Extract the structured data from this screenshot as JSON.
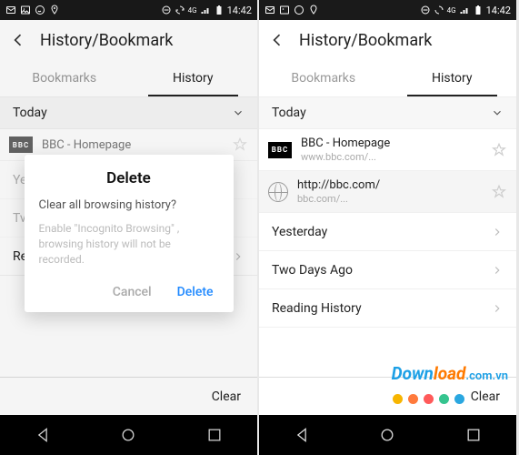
{
  "status": {
    "time": "14:42",
    "net_label": "4G"
  },
  "header": {
    "title": "History/Bookmark"
  },
  "tabs": {
    "bookmarks": "Bookmarks",
    "history": "History"
  },
  "sections": {
    "today": "Today",
    "yesterday": "Yesterday",
    "two_days": "Two Days Ago",
    "reading": "Reading History",
    "yesterday_trunc": "Ye",
    "two_days_trunc": "Tv"
  },
  "entries": {
    "bbc": {
      "title": "BBC - Homepage",
      "url": "www.bbc.com/...",
      "favicon_text": "BBC"
    },
    "bbc2": {
      "title": "http://bbc.com/",
      "url": "bbc.com/..."
    }
  },
  "dialog": {
    "title": "Delete",
    "message": "Clear all browsing history?",
    "hint": "Enable \"Incognito Browsing\" , browsing history will not be recorded.",
    "cancel": "Cancel",
    "confirm": "Delete"
  },
  "bottom": {
    "clear": "Clear"
  },
  "watermark": {
    "part1": "Down",
    "part2": "load",
    "tld": ".com.vn"
  },
  "dot_colors": [
    "#f7b500",
    "#ff7a3c",
    "#ff5a5a",
    "#35c48f",
    "#2aa7e0"
  ]
}
